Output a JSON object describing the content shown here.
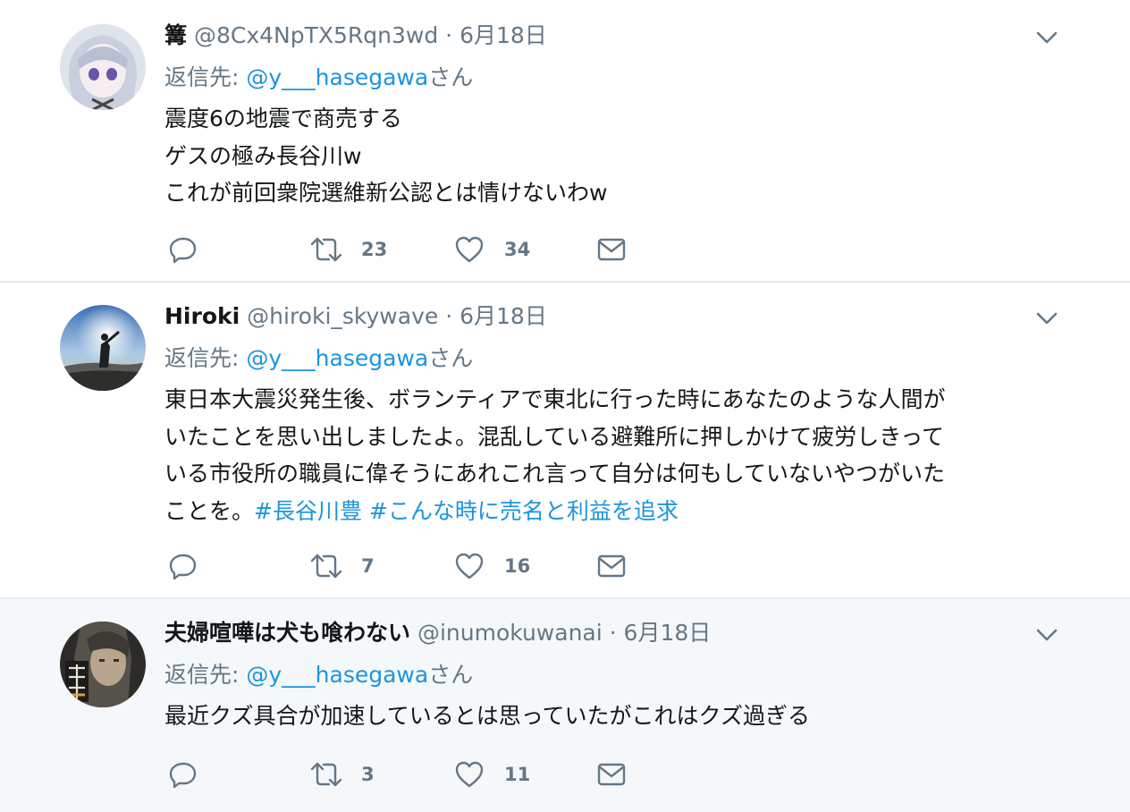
{
  "tweets": [
    {
      "name": "篝",
      "handle": "@8Cx4NpTX5Rqn3wd",
      "dot": "·",
      "date": "6月18日",
      "reply_prefix": "返信先: ",
      "reply_handle": "@y___hasegawa",
      "reply_suffix": "さん",
      "lines": [
        "震度6の地震で商売する",
        "ゲスの極み長谷川w",
        "これが前回衆院選維新公認とは情けないわw"
      ],
      "retweets": "23",
      "likes": "34"
    },
    {
      "name": "Hiroki",
      "handle": "@hiroki_skywave",
      "dot": "·",
      "date": "6月18日",
      "reply_prefix": "返信先: ",
      "reply_handle": "@y___hasegawa",
      "reply_suffix": "さん",
      "lines": [
        "東日本大震災発生後、ボランティアで東北に行った時にあなたのような人間が",
        "いたことを思い出しましたよ。混乱している避難所に押しかけて疲労しきって",
        "いる市役所の職員に偉そうにあれこれ言って自分は何もしていないやつがいた"
      ],
      "last_line_text": "ことを。",
      "hashtags": [
        "#長谷川豊",
        "#こんな時に売名と利益を追求"
      ],
      "retweets": "7",
      "likes": "16"
    },
    {
      "name": "夫婦喧嘩は犬も喰わない",
      "handle": "@inumokuwanai",
      "dot": "·",
      "date": "6月18日",
      "reply_prefix": "返信先: ",
      "reply_handle": "@y___hasegawa",
      "reply_suffix": "さん",
      "lines": [
        "最近クズ具合が加速しているとは思っていたがこれはクズ過ぎる"
      ],
      "retweets": "3",
      "likes": "11"
    }
  ],
  "colors": {
    "text": "#14171a",
    "secondary": "#657786",
    "link": "#1b95e0",
    "divider": "#e6ecf0",
    "highlight_bg": "#f5f8fa"
  },
  "icons": [
    "reply-icon",
    "retweet-icon",
    "like-icon",
    "dm-icon",
    "chevron-down-icon"
  ]
}
